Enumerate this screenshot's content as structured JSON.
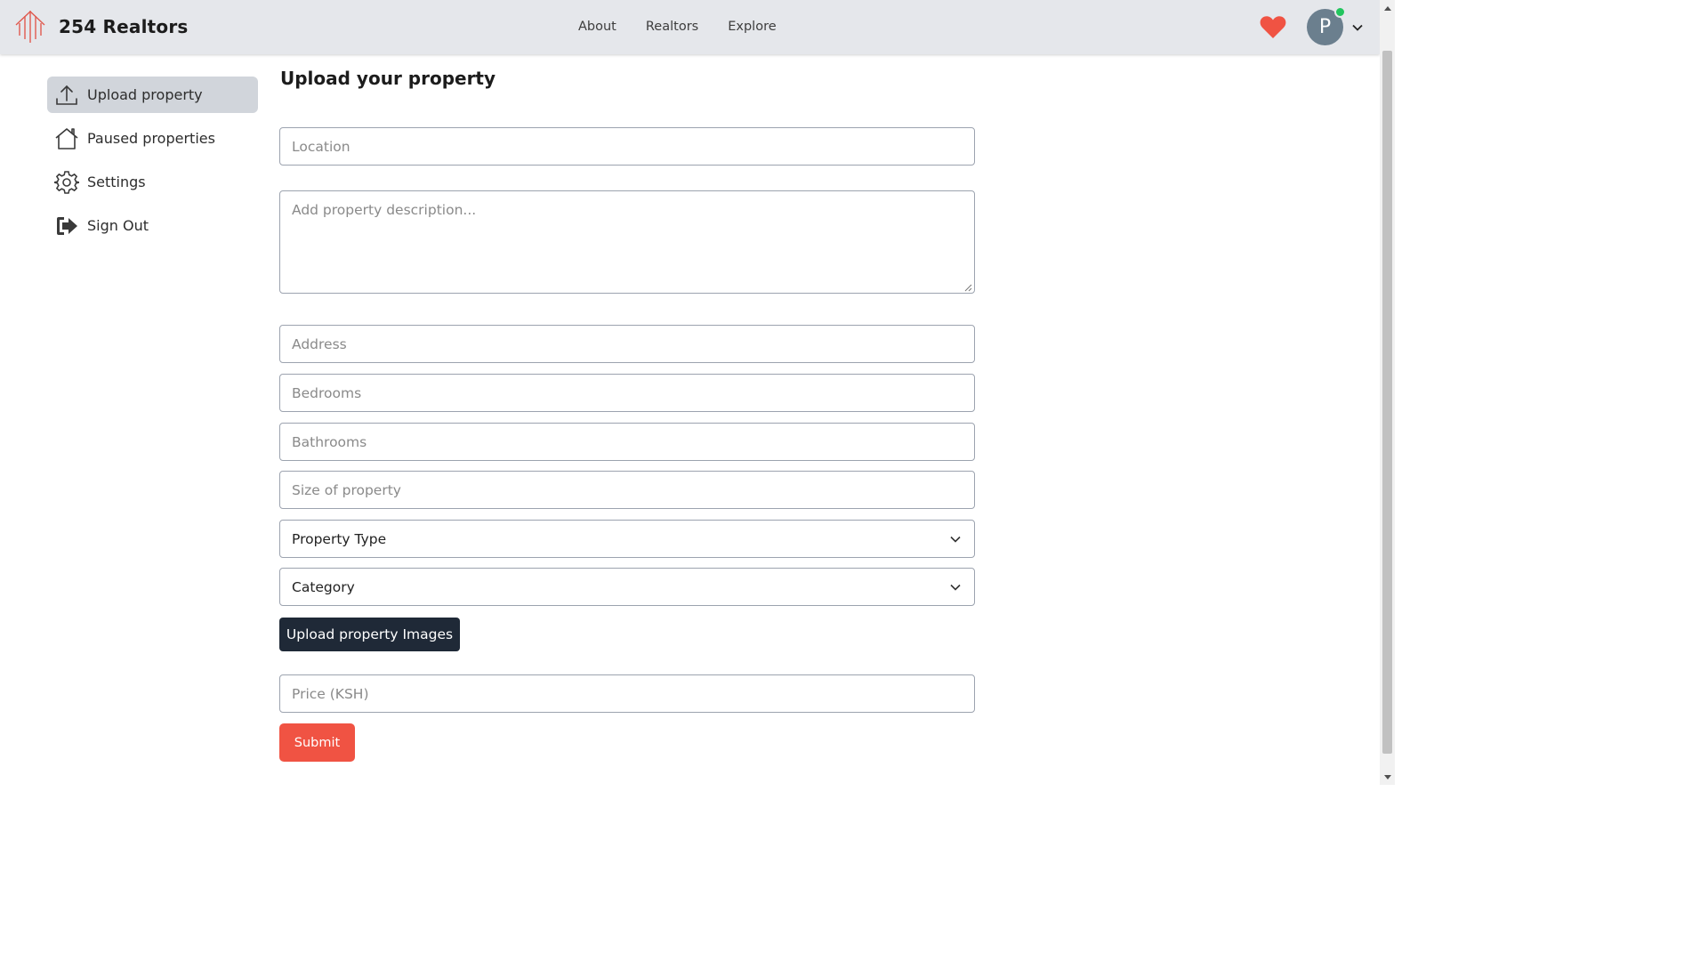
{
  "app": {
    "brand_name": "254 Realtors",
    "brand_color": "#e05a4f"
  },
  "nav": {
    "items": [
      "About",
      "Realtors",
      "Explore"
    ]
  },
  "user": {
    "avatar_initial": "P",
    "status_color": "#22c55e",
    "favorites_icon": "heart-icon"
  },
  "sidebar": {
    "items": [
      {
        "label": "Upload property",
        "icon": "upload-icon",
        "active": true
      },
      {
        "label": "Paused properties",
        "icon": "home-icon",
        "active": false
      },
      {
        "label": "Settings",
        "icon": "gear-icon",
        "active": false
      },
      {
        "label": "Sign Out",
        "icon": "sign-out-icon",
        "active": false
      }
    ]
  },
  "form": {
    "title": "Upload your property",
    "location_placeholder": "Location",
    "description_placeholder": "Add property description...",
    "address_placeholder": "Address",
    "bedrooms_placeholder": "Bedrooms",
    "bathrooms_placeholder": "Bathrooms",
    "size_placeholder": "Size of property",
    "property_type_selected": "Property Type",
    "category_selected": "Category",
    "upload_images_label": "Upload property Images",
    "price_placeholder": "Price (KSH)",
    "submit_label": "Submit",
    "submit_color": "#f05343"
  }
}
